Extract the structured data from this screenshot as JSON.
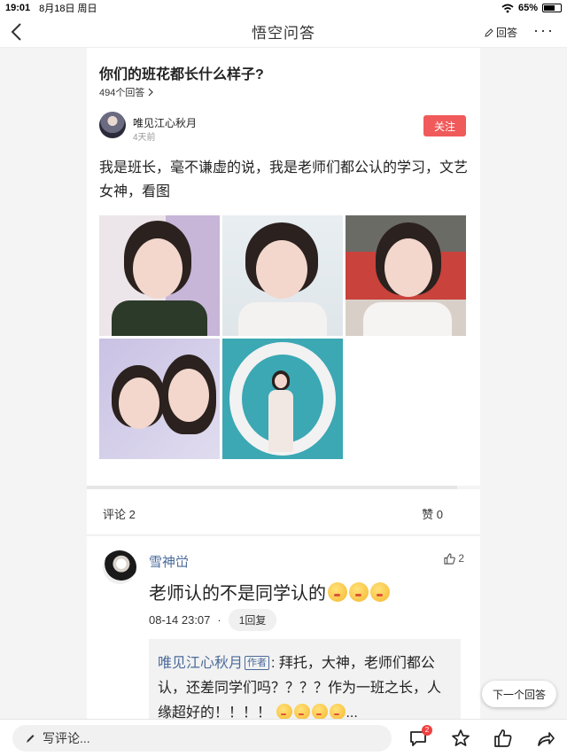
{
  "status_bar": {
    "time": "19:01",
    "date": "8月18日 周日",
    "battery": "65%",
    "battery_level": 0.65
  },
  "nav": {
    "title": "悟空问答",
    "answer_label": "回答",
    "more_label": "···"
  },
  "question": {
    "title": "你们的班花都长什么样子?",
    "answer_count": "494个回答"
  },
  "answer": {
    "author": "唯见江心秋月",
    "time": "4天前",
    "follow_label": "关注",
    "text": "我是班长，毫不谦虚的说，我是老师们都公认的学习，文艺女神，看图"
  },
  "stats": {
    "comments": "评论 2",
    "likes": "赞 0"
  },
  "comment": {
    "user": "雪神峃",
    "likes": "2",
    "text": "老师认的不是同学认的",
    "timestamp": "08-14 23:07",
    "separator": "·",
    "reply_label": "1回复",
    "reply": {
      "name": "唯见江心秋月",
      "tag": "作者",
      "text": ": 拜托，大神，老师们都公认，还差同学们吗？？？？作为一班之长，人缘超好的！！！！",
      "ellipsis": "..."
    }
  },
  "next_answer_label": "下一个回答",
  "bottom_bar": {
    "write_placeholder": "写评论...",
    "comment_badge": "2"
  },
  "colors": {
    "accent_red": "#f05a5a",
    "link_blue": "#4a6b9a"
  }
}
